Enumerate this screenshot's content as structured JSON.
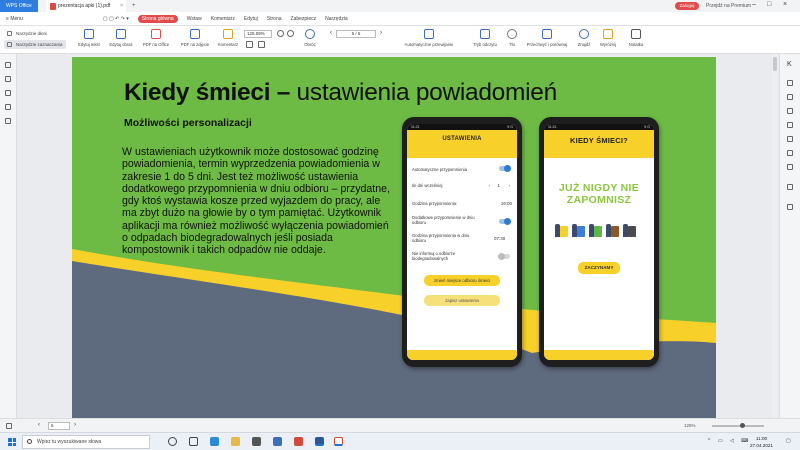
{
  "titlebar": {
    "app_tab": "WPS Office",
    "doc_tab": "prezentacja apki (1).pdf",
    "login": "Zaloguj",
    "premium": "Przejdź na Premium"
  },
  "menu": {
    "menu_label": "Menu",
    "items": [
      "Strona główna",
      "Wstaw",
      "Komentarz",
      "Edytuj",
      "Strona",
      "Zabezpiecz",
      "Narzędzia"
    ]
  },
  "ribbon": {
    "side_tools": [
      "Narzędzie dłoni",
      "Narzędzie zaznaczania"
    ],
    "buttons": [
      "Edytuj tekst",
      "Edytuj obraz",
      "PDF na Office",
      "PDF na zdjęcie",
      "Komentarz",
      "Obróć",
      "Automatyczne przewijanie",
      "Tryb odczytu",
      "Tło",
      "Przechwyć i porównaj",
      "Znajdź",
      "Wyróżnij",
      "Notatka"
    ],
    "zoom": "125.09%",
    "page": "6 / 6"
  },
  "slide": {
    "title_bold": "Kiedy śmieci –",
    "title_rest": " ustawienia powiadomień",
    "subtitle": "Możliwości personalizacji",
    "body": "W ustawieniach użytkownik może dostosować godzinę powiadomienia, termin wyprzedzenia powiadomienia w zakresie 1 do 5 dni. Jest też możliwość ustawienia dodatkowego przypomnienia w dniu odbioru – przydatne, gdy ktoś wystawia kosze przed wyjazdem do pracy, ale ma zbyt dużo na głowie by o tym pamiętać. Użytkownik aplikacji ma również możliwość wyłączenia powiadomień o odpadach biodegradowalnych jeśli posiada kompostownik i takich odpadów nie oddaje."
  },
  "phone1": {
    "status_time": "11:21",
    "status_right": "5 G",
    "header": "USTAWIENIA",
    "auto_reminder": "Automatyczne przypomnienia",
    "days_early": "Ile dni wcześniej",
    "days_value": "1",
    "reminder_hour": "Godzina przypomnienia:",
    "reminder_hour_value": "19:00",
    "extra_reminder": "Dodatkowe przypomnienie w dniu odbioru",
    "pickup_hour": "Godzina przypomnienia w dniu odbioru",
    "pickup_hour_value": "07:30",
    "bio_off": "Nie informuj o odbiorze biodegradowalnych",
    "change_place": "zmień miejsce odbioru śmieci",
    "save": "zapisz ustawienia"
  },
  "phone2": {
    "status_time": "11:21",
    "status_right": "5 G",
    "header": "KIEDY ŚMIECI?",
    "slogan_line1": "JUŻ NIGDY NIE",
    "slogan_line2": "ZAPOMNISZ",
    "start": "ZACZYNAMY"
  },
  "statusbar": {
    "page": "6",
    "zoom": "125%"
  },
  "taskbar": {
    "search": "Wpisz tu wyszukiwane słowa",
    "time": "11:00",
    "date": "27.04.2021"
  },
  "colors": {
    "green": "#6dbb44",
    "yellow": "#f7d02a",
    "slate": "#5e6a7d",
    "wps_blue": "#2f7de1",
    "accent_red": "#e24b4b"
  }
}
